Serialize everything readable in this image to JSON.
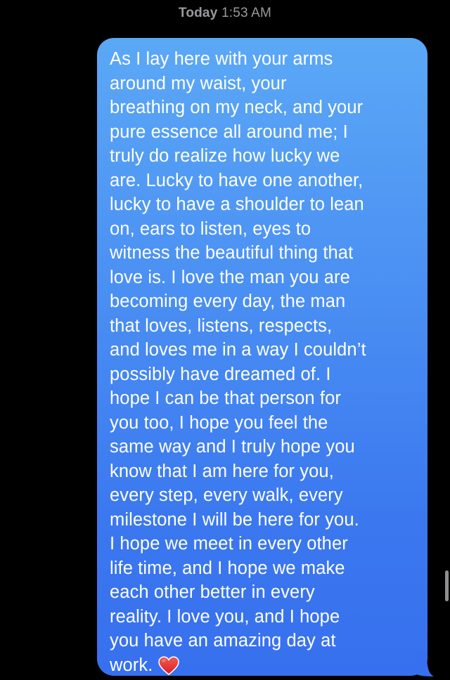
{
  "header": {
    "timestamp_day": "Today",
    "timestamp_time": "1:53 AM"
  },
  "message": {
    "direction": "sent",
    "lines": [
      "As I lay here with your arms",
      "around my waist, your",
      "breathing on my neck, and your",
      "pure essence all around me; I",
      "truly do realize how lucky we",
      "are. Lucky to have one another,",
      "lucky to have a shoulder to lean",
      "on, ears to listen, eyes to",
      "witness the beautiful thing that",
      "love is. I love the man you are",
      "becoming every day, the man",
      "that loves, listens, respects,",
      "and loves me in a way I couldn’t",
      "possibly have dreamed of. I",
      "hope I can be that person for",
      "you too, I hope you feel the",
      "same way and I truly hope you",
      "know that I am here for you,",
      "every step, every walk, every",
      "milestone I will be here for you.",
      "I hope we meet in every other",
      "life time, and I hope we make",
      "each other better in every",
      "reality. I love you, and I hope",
      "you have an amazing day at",
      "work."
    ],
    "emoji": "heart-icon"
  },
  "colors": {
    "background": "#000000",
    "bubble_top": "#5ba8f6",
    "bubble_bottom": "#3770ee",
    "timestamp": "#9a9a9e",
    "heart": "#e8302f"
  }
}
